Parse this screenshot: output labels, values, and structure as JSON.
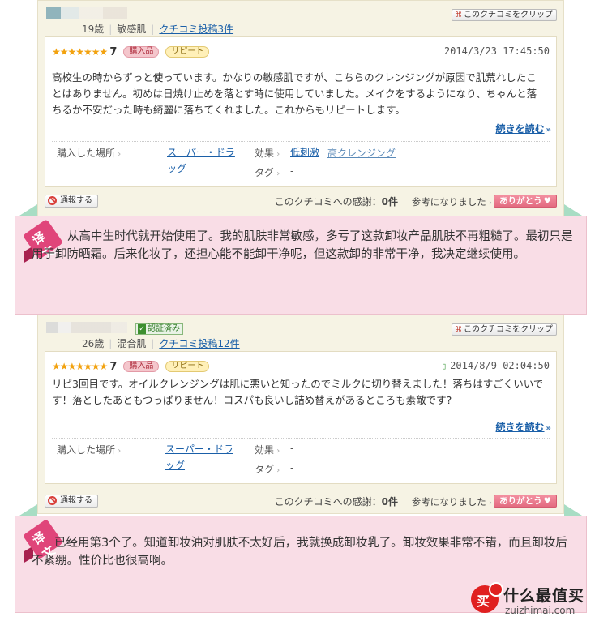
{
  "reviews": [
    {
      "age": "19歳",
      "skin": "敏感肌",
      "posts_link": "クチコミ投稿3件",
      "verified": "",
      "clip_label": "このクチコミをクリップ",
      "stars": "★★★★★★★",
      "score": "7",
      "tag_purchase": "購入品",
      "tag_repeat": "リピート",
      "date": "2014/3/23 17:45:50",
      "text": "高校生の時からずっと使っています。かなりの敏感肌ですが、こちらのクレンジングが原因で肌荒れしたことはありません。初めは日焼け止めを落とす時に使用していました。メイクをするようになり、ちゃんと落ちるか不安だった時も綺麗に落ちてくれました。これからもリピートします。",
      "read_more": "続きを読む",
      "place_label": "購入した場所",
      "place_value": "スーパー・ドラッグ",
      "effect_label": "効果",
      "effect_values": [
        "低刺激",
        "高クレンジング"
      ],
      "tag_label": "タグ",
      "tag_value": "-",
      "report_label": "通報する",
      "thanks_prefix": "このクチコミへの感謝：",
      "thanks_count": "0件",
      "helpful_label": "参考になりました",
      "thanks_button": "ありがとう",
      "translation_badge": "译文",
      "translation": "从高中生时代就开始使用了。我的肌肤非常敏感，多亏了这款卸妆产品肌肤不再粗糙了。最初只是用于卸防晒霜。后来化妆了，还担心能不能卸干净呢，但这款卸的非常干净，我决定继续使用。"
    },
    {
      "age": "26歳",
      "skin": "混合肌",
      "posts_link": "クチコミ投稿12件",
      "verified": "認証済み",
      "clip_label": "このクチコミをクリップ",
      "stars": "★★★★★★★",
      "score": "7",
      "tag_purchase": "購入品",
      "tag_repeat": "リピート",
      "date": "2014/8/9 02:04:50",
      "text": "リピ3回目です。オイルクレンジングは肌に悪いと知ったのでミルクに切り替えました！落ちはすごくいいです！落としたあともつっぱりません！コスパも良いし詰め替えがあるところも素敵です?",
      "read_more": "続きを読む",
      "place_label": "購入した場所",
      "place_value": "スーパー・ドラッグ",
      "effect_label": "効果",
      "effect_values": [
        "-"
      ],
      "tag_label": "タグ",
      "tag_value": "-",
      "report_label": "通報する",
      "thanks_prefix": "このクチコミへの感謝：",
      "thanks_count": "0件",
      "helpful_label": "参考になりました",
      "thanks_button": "ありがとう",
      "translation_badge": "译文",
      "translation": "已经用第3个了。知道卸妆油对肌肤不太好后，我就换成卸妆乳了。卸妆效果非常不错，而且卸妆后不紧绷。性价比也很高啊。"
    }
  ],
  "watermark": {
    "title": "什么最值买",
    "url": "zuizhimai.com"
  },
  "colors": {
    "link": "#1a5fa8",
    "star": "#f2a20f",
    "card_bg": "#f6f3e4",
    "translation_bg": "#f9dde6",
    "badge_pink": "#e0457a",
    "thanks_button": "#e36b80"
  }
}
